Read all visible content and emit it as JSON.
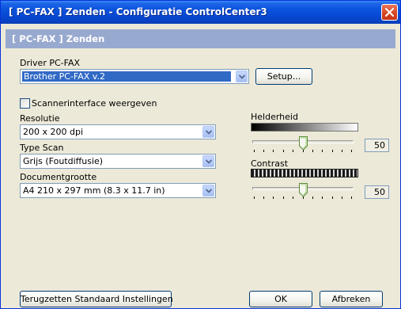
{
  "window": {
    "title": "[ PC-FAX ]  Zenden - Configuratie ControlCenter3"
  },
  "header": {
    "title": "[ PC-FAX ]  Zenden"
  },
  "driver": {
    "label": "Driver PC-FAX",
    "value": "Brother PC-FAX v.2",
    "setup_label": "Setup..."
  },
  "scanner_interface": {
    "label": "Scannerinterface weergeven",
    "checked": false
  },
  "resolution": {
    "label": "Resolutie",
    "value": "200 x 200 dpi"
  },
  "scan_type": {
    "label": "Type Scan",
    "value": "Grijs (Foutdiffusie)"
  },
  "document_size": {
    "label": "Documentgrootte",
    "value": "A4 210 x 297 mm (8.3 x 11.7 in)"
  },
  "brightness": {
    "label": "Helderheid",
    "value": "50"
  },
  "contrast": {
    "label": "Contrast",
    "value": "50"
  },
  "buttons": {
    "reset_label": "Terugzetten Standaard Instellingen",
    "ok_label": "OK",
    "cancel_label": "Afbreken"
  }
}
